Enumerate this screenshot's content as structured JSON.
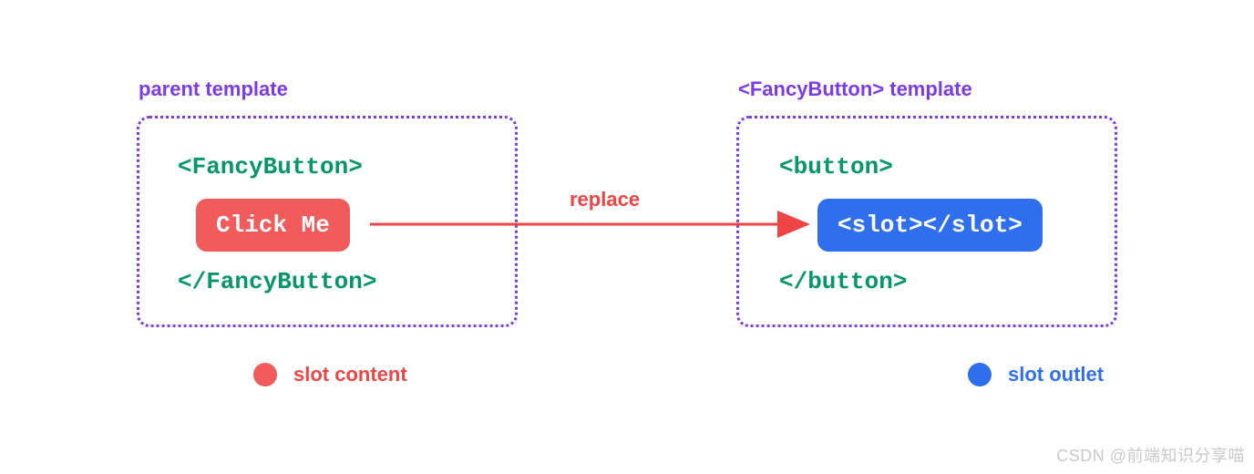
{
  "left": {
    "title": "parent template",
    "tag_open": "<FancyButton>",
    "content": "Click Me",
    "tag_close": "</FancyButton>"
  },
  "right": {
    "title": "<FancyButton> template",
    "tag_open": "<button>",
    "content": "<slot></slot>",
    "tag_close": "</button>"
  },
  "arrow_label": "replace",
  "legend": {
    "left": "slot content",
    "right": "slot outlet"
  },
  "watermark": "CSDN @前端知识分享喵",
  "colors": {
    "purple": "#7c3aed",
    "green": "#059669",
    "red": "#f15b5b",
    "red_text": "#ef4444",
    "blue": "#2f6fed"
  }
}
